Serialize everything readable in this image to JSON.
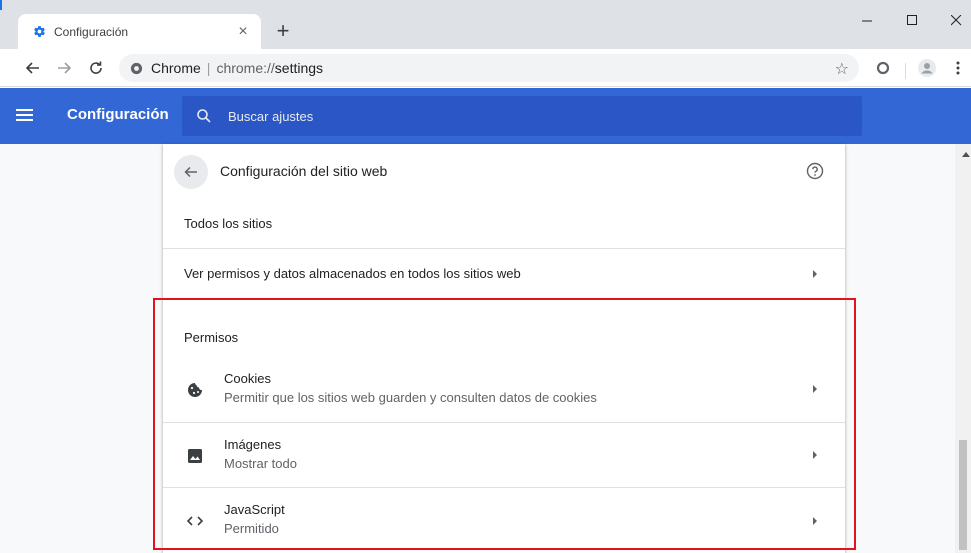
{
  "tab": {
    "title": "Configuración",
    "close": "×",
    "new_tab": "+"
  },
  "window": {
    "minimize": "–",
    "maximize": "☐",
    "close": "✕"
  },
  "toolbar": {
    "back": "←",
    "forward": "→",
    "reload": "C",
    "omnibox_site": "Chrome",
    "omnibox_sep": "|",
    "omnibox_scheme": "chrome://",
    "omnibox_path": "settings",
    "star": "☆"
  },
  "header": {
    "title": "Configuración",
    "search_placeholder": "Buscar ajustes"
  },
  "page": {
    "title": "Configuración del sitio web",
    "all_sites_section": "Todos los sitios",
    "all_sites_row": "Ver permisos y datos almacenados en todos los sitios web",
    "permissions_section": "Permisos",
    "items": [
      {
        "label": "Cookies",
        "sub": "Permitir que los sitios web guarden y consulten datos de cookies",
        "icon": "cookie-icon"
      },
      {
        "label": "Imágenes",
        "sub": "Mostrar todo",
        "icon": "image-icon"
      },
      {
        "label": "JavaScript",
        "sub": "Permitido",
        "icon": "code-icon"
      }
    ]
  },
  "colors": {
    "header": "#3367d6",
    "search": "#2a56c6",
    "highlight": "#e1141e"
  }
}
